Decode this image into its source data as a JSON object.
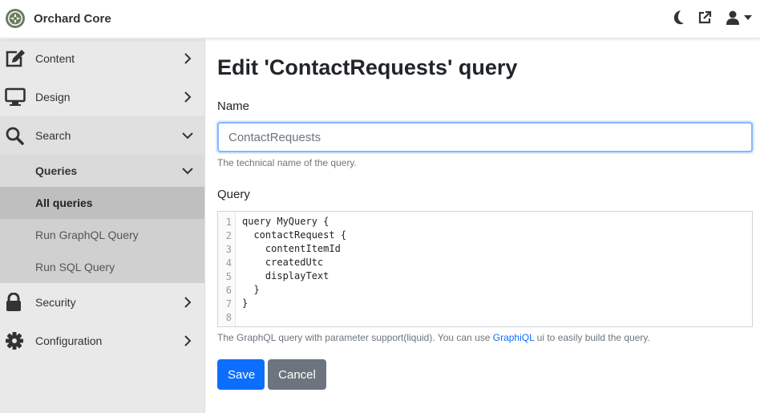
{
  "app": {
    "title": "Orchard Core"
  },
  "sidebar": {
    "content": {
      "label": "Content"
    },
    "design": {
      "label": "Design"
    },
    "search": {
      "label": "Search"
    },
    "queries": {
      "label": "Queries"
    },
    "all_queries": {
      "label": "All queries"
    },
    "run_graphql": {
      "label": "Run GraphQL Query"
    },
    "run_sql": {
      "label": "Run SQL Query"
    },
    "security": {
      "label": "Security"
    },
    "configuration": {
      "label": "Configuration"
    }
  },
  "page": {
    "title": "Edit 'ContactRequests' query",
    "name_label": "Name",
    "name_value": "ContactRequests",
    "name_help": "The technical name of the query.",
    "query_label": "Query",
    "query_lines": [
      "query MyQuery {",
      "  contactRequest {",
      "    contentItemId",
      "    createdUtc",
      "    displayText",
      "  }",
      "}",
      ""
    ],
    "line_numbers": [
      "1",
      "2",
      "3",
      "4",
      "5",
      "6",
      "7",
      "8"
    ],
    "query_help_prefix": "The GraphQL query with parameter support(liquid). You can use ",
    "query_help_link": "GraphiQL",
    "query_help_suffix": " ui to easily build the query.",
    "save_label": "Save",
    "cancel_label": "Cancel"
  },
  "colors": {
    "primary": "#0d6efd",
    "secondary": "#6c757d",
    "sidebar": "#e9e9e9"
  },
  "icons": [
    "orchard-logo",
    "moon-icon",
    "external-link-icon",
    "user-icon",
    "edit-icon",
    "monitor-icon",
    "search-icon",
    "lock-icon",
    "gear-icon"
  ]
}
